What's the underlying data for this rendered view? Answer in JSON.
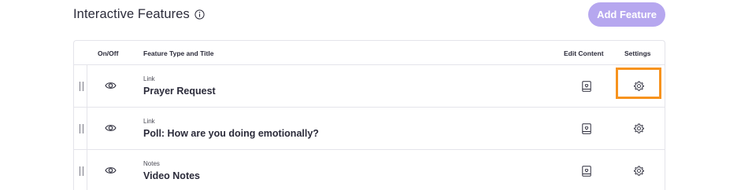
{
  "header": {
    "title": "Interactive Features",
    "add_button_label": "Add Feature"
  },
  "table": {
    "columns": {
      "onoff": "On/Off",
      "type_title": "Feature Type and Title",
      "edit": "Edit Content",
      "settings": "Settings"
    },
    "rows": [
      {
        "type": "Link",
        "title": "Prayer Request"
      },
      {
        "type": "Link",
        "title": "Poll: How are you doing emotionally?"
      },
      {
        "type": "Notes",
        "title": "Video Notes"
      }
    ]
  },
  "colors": {
    "accent": "#b6a7ef",
    "highlight": "#f7931e"
  }
}
